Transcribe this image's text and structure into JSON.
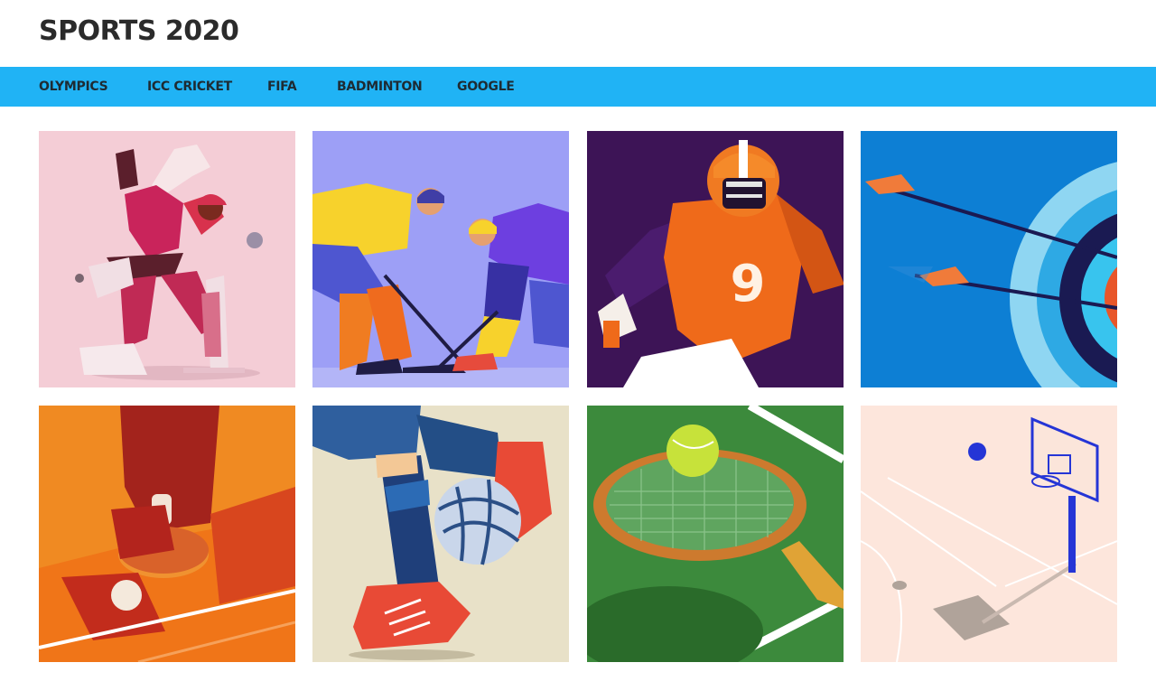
{
  "header": {
    "title": "SPORTS 2020"
  },
  "nav": {
    "items": [
      {
        "label": "OLYMPICS"
      },
      {
        "label": "ICC CRICKET"
      },
      {
        "label": "FIFA"
      },
      {
        "label": "BADMINTON"
      },
      {
        "label": "GOOGLE"
      }
    ]
  },
  "colors": {
    "nav_bar": "#20b3f5",
    "title_text": "#2b2b2b"
  },
  "gallery": {
    "tiles": [
      {
        "subject": "cricket batsman",
        "jersey_number": ""
      },
      {
        "subject": "ice hockey players",
        "jersey_number": ""
      },
      {
        "subject": "american football player",
        "jersey_number": "9"
      },
      {
        "subject": "archery arrows and target",
        "jersey_number": ""
      },
      {
        "subject": "table tennis paddle and ball",
        "jersey_number": ""
      },
      {
        "subject": "football boot and ball",
        "jersey_number": ""
      },
      {
        "subject": "tennis racket and ball",
        "jersey_number": ""
      },
      {
        "subject": "basketball hoop and court",
        "jersey_number": ""
      }
    ]
  }
}
